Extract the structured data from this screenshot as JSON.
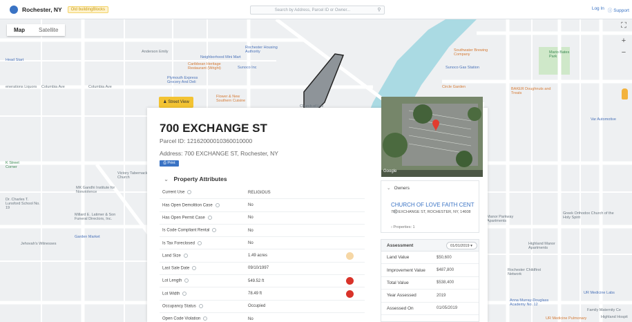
{
  "brand": {
    "city": "Rochester, NY",
    "beta": "Old buildingBlocks"
  },
  "search": {
    "placeholder": "Search by Address, Parcel ID or Owner..."
  },
  "top_links": {
    "login": "Log In",
    "support": "Support"
  },
  "map": {
    "map_label": "Map",
    "satellite_label": "Satellite",
    "street_view": "Street View",
    "labels": {
      "anderson": "Anderson Emily",
      "head_start": "Head Start",
      "columbia": "Columbia Ave",
      "columbia2": "Columbia Ave",
      "liquors": "enerations Liquors",
      "rochester_housing": "Rochester Housing Authority",
      "neighborhood": "Neighborhood Mini Mart",
      "caribbean": "Caribbean Heritage Restaurant (Wright)",
      "sunoco": "Sunoco Inc",
      "plymouth": "Plymouth Express Grocery And Deli",
      "flower": "Flower & New Southern Cuisine",
      "church_map": "Church of Lov",
      "southwater": "Southwater Brewing Company",
      "sunoco_gas": "Sunoco Gas Station",
      "circle_garden": "Circle Garden",
      "baker": "BAKER Doughnuts and Treats",
      "mario": "Mario Bates Park",
      "var_automotive": "Var Automotive",
      "k_street": "K Street Corner",
      "tabernacle": "Victory Tabernacle Church",
      "gandhi": "MK Gandhi Institute for Nonviolence",
      "dr_charles": "Dr. Charles T. Lunsford School No. 19",
      "millard": "Millard E. Latimer & Son Funeral Directors, Inc.",
      "garden": "Garden Market",
      "jehovah": "Jehovah's Witnesses",
      "greek": "Greek Orthodox Church of the Holy Spirit",
      "manor_parkway": "Manor Parkway Apartments",
      "highland": "Highland Manor Apartments",
      "rochester_child": "Rochester Childfirst Network",
      "anna": "Anna Murray-Douglass Academy No. 12",
      "ur_labs": "UR Medicine Labs",
      "family": "Family Maternity Ce",
      "ur_pulmonary": "UR Medicine Pulmonary",
      "highland_hospital": "Highland Hospit"
    }
  },
  "property": {
    "address": "700 EXCHANGE ST",
    "parcel_id": "Parcel ID: 12162000010360010000",
    "full_address": "Address: 700 EXCHANGE ST, Rochester, NY",
    "print": "Print",
    "section_title": "Property Attributes",
    "attributes": [
      {
        "label": "Current Use",
        "value": "RELIGIOUS",
        "dot": ""
      },
      {
        "label": "Has Open Demolition Case",
        "value": "No",
        "dot": ""
      },
      {
        "label": "Has Open Permit Case",
        "value": "No",
        "dot": ""
      },
      {
        "label": "Is Code Compliant Rental",
        "value": "No",
        "dot": ""
      },
      {
        "label": "Is Tax Foreclosed",
        "value": "No",
        "dot": ""
      },
      {
        "label": "Land Size",
        "value": "1.49 acres",
        "dot": "#f6d7a5"
      },
      {
        "label": "Last Sale Date",
        "value": "09/10/1997",
        "dot": ""
      },
      {
        "label": "Lot Length",
        "value": "549.52 ft",
        "dot": "#d9332a"
      },
      {
        "label": "Lot Width",
        "value": "78.49 ft",
        "dot": "#d9332a"
      },
      {
        "label": "Occupancy Status",
        "value": "Occupied",
        "dot": ""
      },
      {
        "label": "Open Code Violation",
        "value": "No",
        "dot": ""
      }
    ]
  },
  "owners": {
    "title": "Owners",
    "name": "CHURCH OF LOVE FAITH CENT",
    "address": "700 EXCHANGE ST, ROCHESTER, NY, 14608",
    "properties": "Properties: 1"
  },
  "assessment": {
    "title": "Assessment",
    "year_selected": "01/01/2019",
    "rows": [
      {
        "label": "Land Value",
        "value": "$50,600"
      },
      {
        "label": "Improvement Value",
        "value": "$487,800"
      },
      {
        "label": "Total Value",
        "value": "$538,400"
      },
      {
        "label": "Year Assessed",
        "value": "2019"
      },
      {
        "label": "Assessed On",
        "value": "01/05/2019"
      }
    ]
  },
  "photo": {
    "attribution": "Google"
  }
}
